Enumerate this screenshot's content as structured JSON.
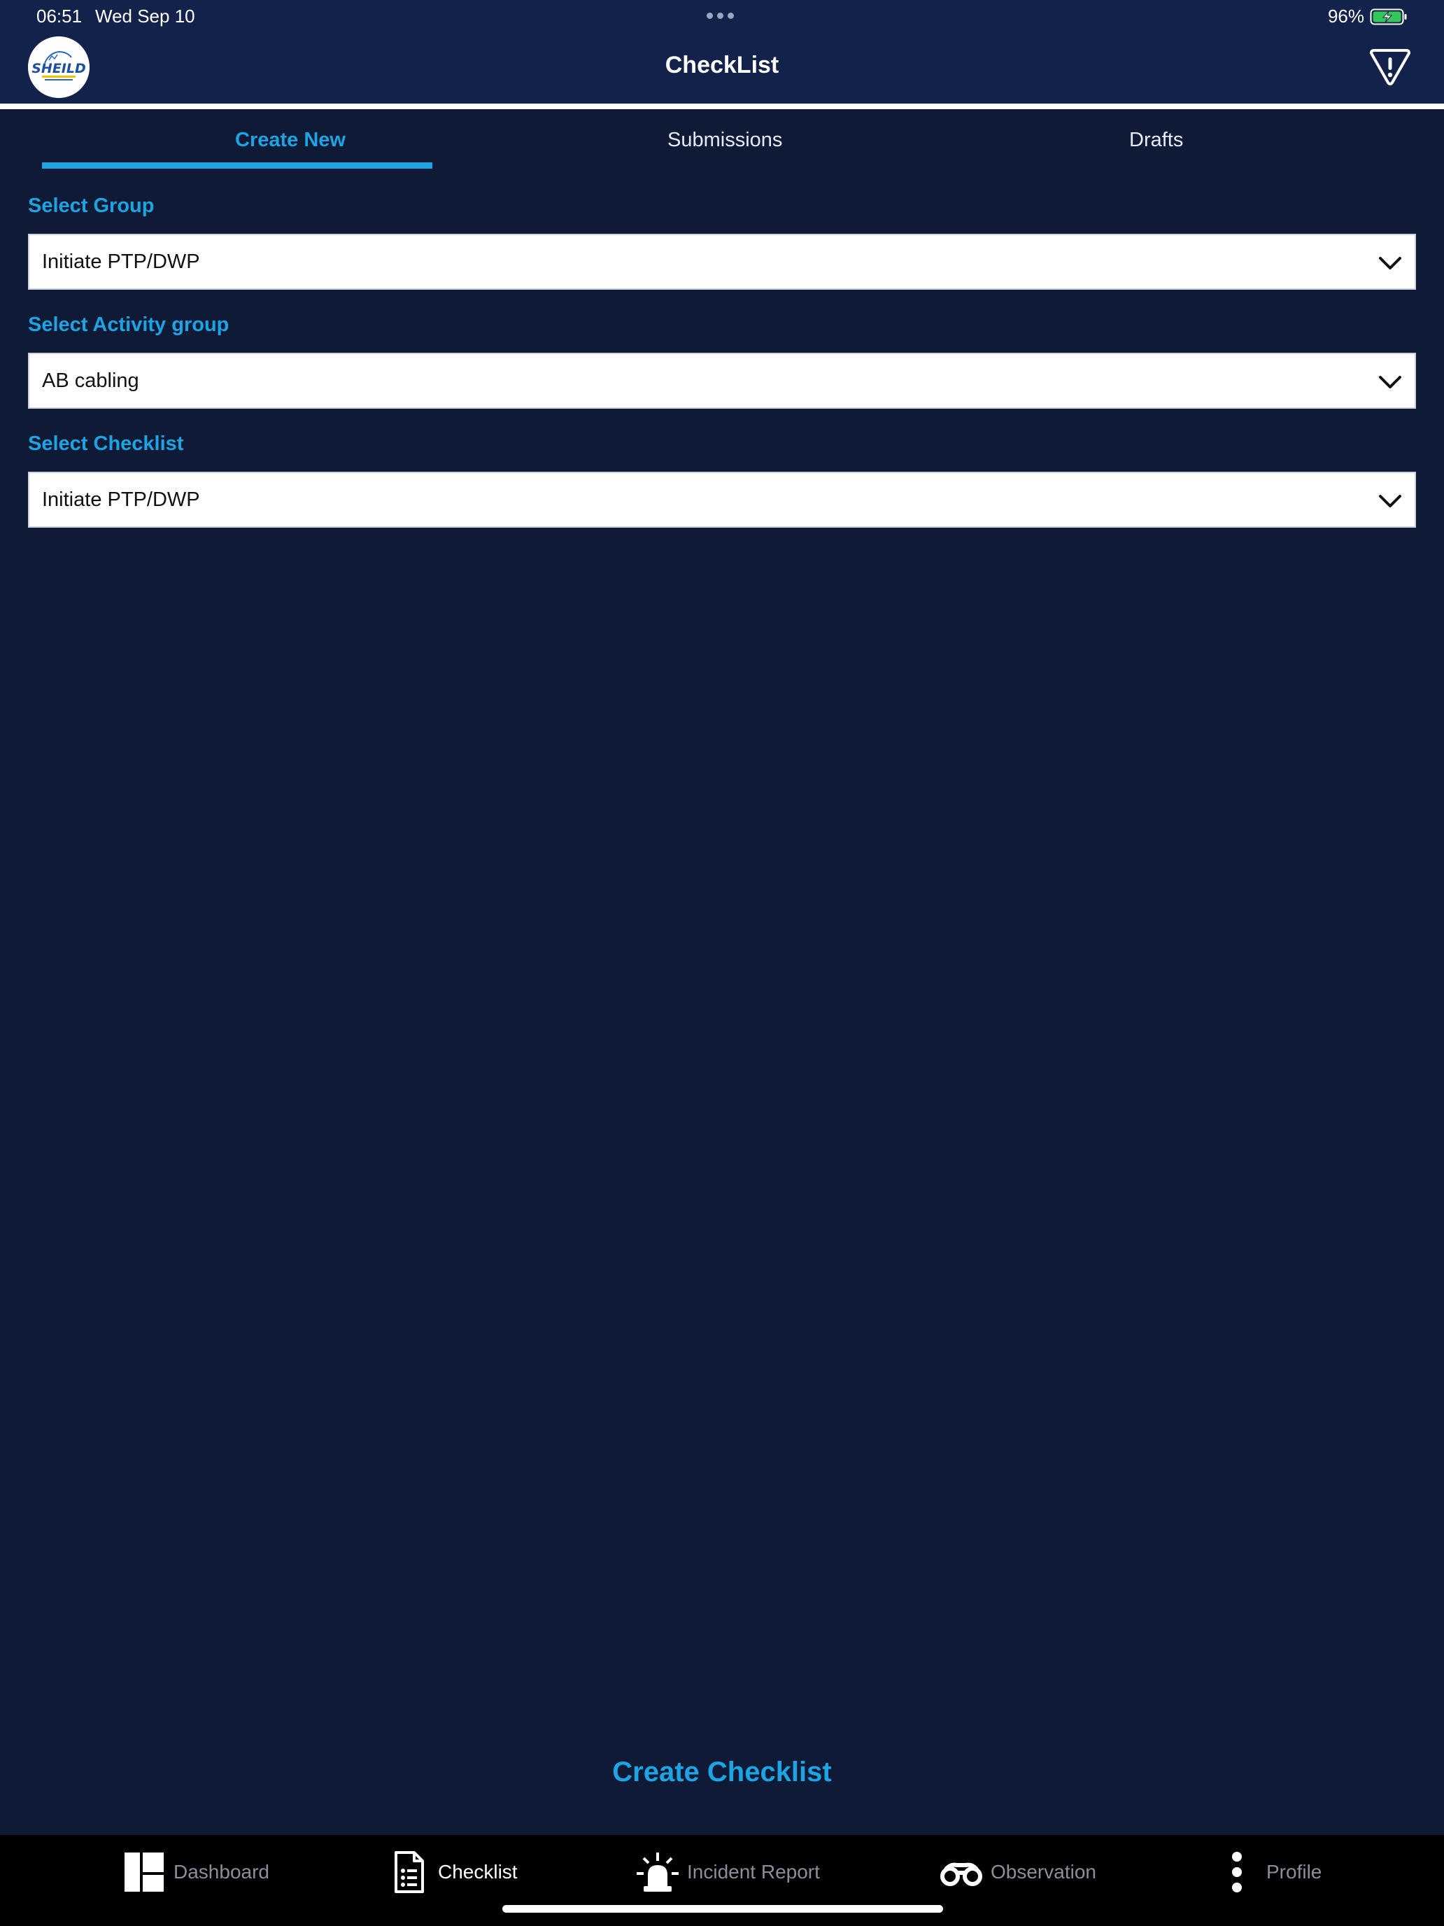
{
  "status_bar": {
    "time": "06:51",
    "date": "Wed Sep 10",
    "battery": "96%"
  },
  "header": {
    "title": "CheckList",
    "logo_text": "SHEILD",
    "alert_icon": "alert-triangle-icon"
  },
  "tabs": [
    {
      "label": "Create New",
      "active": true
    },
    {
      "label": "Submissions",
      "active": false
    },
    {
      "label": "Drafts",
      "active": false
    }
  ],
  "form": {
    "group": {
      "label": "Select Group",
      "value": "Initiate PTP/DWP"
    },
    "activity_group": {
      "label": "Select Activity group",
      "value": "AB cabling"
    },
    "checklist": {
      "label": "Select Checklist",
      "value": "Initiate PTP/DWP"
    }
  },
  "actions": {
    "create_label": "Create Checklist"
  },
  "bottom_nav": [
    {
      "label": "Dashboard",
      "icon": "dashboard-icon",
      "active": false
    },
    {
      "label": "Checklist",
      "icon": "checklist-icon",
      "active": true
    },
    {
      "label": "Incident Report",
      "icon": "siren-icon",
      "active": false
    },
    {
      "label": "Observation",
      "icon": "binoculars-icon",
      "active": false
    },
    {
      "label": "Profile",
      "icon": "more-vertical-icon",
      "active": false
    }
  ],
  "colors": {
    "background": "#0f1b36",
    "header": "#13224a",
    "accent": "#1ea3e3",
    "nav_background": "#000000"
  }
}
